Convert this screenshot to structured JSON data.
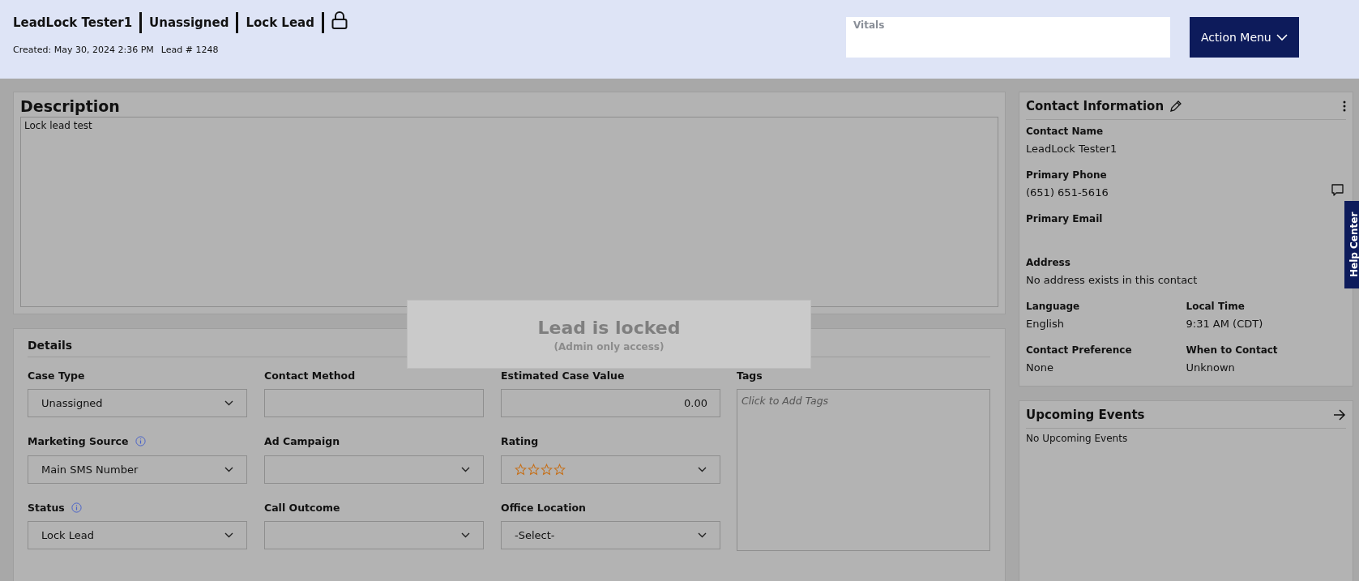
{
  "header": {
    "title_parts": [
      "LeadLock Tester1",
      "Unassigned",
      "Lock Lead"
    ],
    "locked": true,
    "created": "Created: May 30, 2024 2:36 PM",
    "lead_number": "Lead # 1248",
    "vitals": {
      "label": "Vitals"
    },
    "action_button": "Action Menu"
  },
  "description": {
    "title": "Description",
    "text": "Lock lead test"
  },
  "lock_notice": {
    "title": "Lead is locked",
    "subtitle": "(Admin only access)"
  },
  "details": {
    "title": "Details",
    "fields": [
      {
        "label": "Case Type",
        "kind": "select",
        "value": "Unassigned",
        "info": false
      },
      {
        "label": "Contact Method",
        "kind": "input",
        "info": false
      },
      {
        "label": "Estimated Case Value",
        "kind": "number",
        "value": "0.00",
        "info": false
      },
      {
        "label": "Marketing Source",
        "kind": "select",
        "value": "Main SMS Number",
        "info": true
      },
      {
        "label": "Ad Campaign",
        "kind": "select",
        "info": false
      },
      {
        "label": "Rating",
        "kind": "rating",
        "stars": 0,
        "info": false
      },
      {
        "label": "Status",
        "kind": "select",
        "value": "Lock Lead",
        "info": true
      },
      {
        "label": "Call Outcome",
        "kind": "select",
        "info": false
      },
      {
        "label": "Office Location",
        "kind": "select",
        "value": "-Select-",
        "info": false
      }
    ],
    "tags": {
      "label": "Tags",
      "placeholder": "Click to Add Tags"
    }
  },
  "contact": {
    "title": "Contact Information",
    "fields": [
      {
        "label": "Contact Name",
        "value": "LeadLock Tester1",
        "kind": "full"
      },
      {
        "label": "Primary Phone",
        "value": "(651) 651-5616",
        "kind": "phone"
      },
      {
        "label": "Primary Email",
        "kind": "full"
      },
      {
        "label": "Address",
        "value": "No address exists in this contact",
        "kind": "full"
      },
      {
        "label": "Language",
        "value": "English",
        "kind": "half"
      },
      {
        "label": "Local Time",
        "value": "9:31 AM (CDT)",
        "kind": "half"
      },
      {
        "label": "Contact Preference",
        "value": "None",
        "kind": "half"
      },
      {
        "label": "When to Contact",
        "value": "Unknown",
        "kind": "half"
      }
    ]
  },
  "events": {
    "title": "Upcoming Events",
    "empty_text": "No Upcoming Events"
  },
  "help_tab": "Help Center"
}
